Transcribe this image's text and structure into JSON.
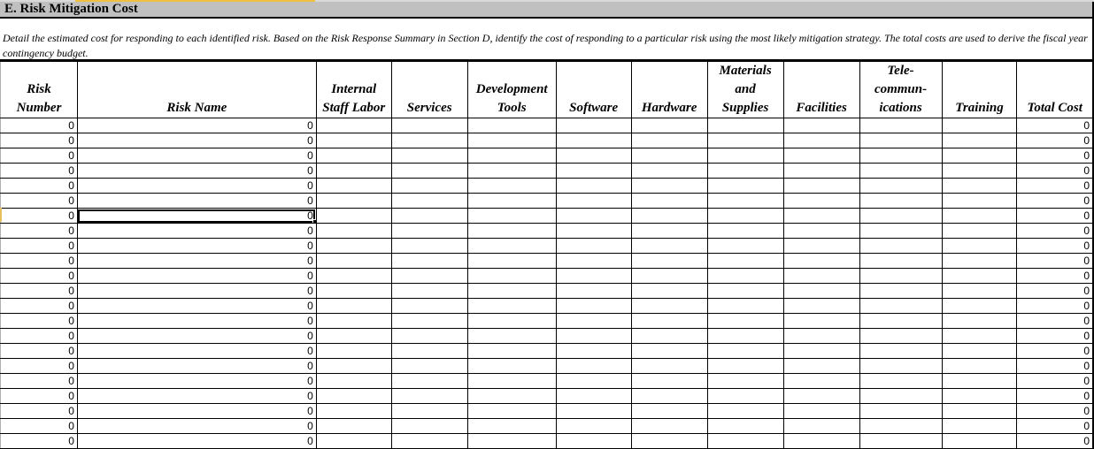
{
  "section": {
    "title": "E.  Risk Mitigation Cost",
    "description": "Detail the estimated cost for responding to each identified risk.  Based on the Risk Response Summary in Section D, identify the cost of responding to a particular risk using the most likely mitigation strategy.  The total costs are used to derive the fiscal year contingency budget."
  },
  "table": {
    "columns": [
      {
        "key": "risk_number",
        "label": "Risk Number"
      },
      {
        "key": "risk_name",
        "label": "Risk Name"
      },
      {
        "key": "internal_staff_labor",
        "label": "Internal Staff Labor"
      },
      {
        "key": "services",
        "label": "Services"
      },
      {
        "key": "development_tools",
        "label": "Development Tools"
      },
      {
        "key": "software",
        "label": "Software"
      },
      {
        "key": "hardware",
        "label": "Hardware"
      },
      {
        "key": "materials_and_supplies",
        "label": "Materials and Supplies"
      },
      {
        "key": "facilities",
        "label": "Facilities"
      },
      {
        "key": "telecommunications",
        "label": "Tele-communications"
      },
      {
        "key": "training",
        "label": "Training"
      },
      {
        "key": "total_cost",
        "label": "Total Cost"
      }
    ],
    "header_lines": [
      [
        "Risk",
        "Number"
      ],
      [
        "Risk Name"
      ],
      [
        "Internal",
        "Staff Labor"
      ],
      [
        "Services"
      ],
      [
        "Development",
        "Tools"
      ],
      [
        "Software"
      ],
      [
        "Hardware"
      ],
      [
        "Materials",
        "and",
        "Supplies"
      ],
      [
        "Facilities"
      ],
      [
        "Tele-",
        "commun-",
        "ications"
      ],
      [
        "Training"
      ],
      [
        "Total Cost"
      ]
    ],
    "rows": [
      [
        "0",
        "0",
        "",
        "",
        "",
        "",
        "",
        "",
        "",
        "",
        "",
        "0"
      ],
      [
        "0",
        "0",
        "",
        "",
        "",
        "",
        "",
        "",
        "",
        "",
        "",
        "0"
      ],
      [
        "0",
        "0",
        "",
        "",
        "",
        "",
        "",
        "",
        "",
        "",
        "",
        "0"
      ],
      [
        "0",
        "0",
        "",
        "",
        "",
        "",
        "",
        "",
        "",
        "",
        "",
        "0"
      ],
      [
        "0",
        "0",
        "",
        "",
        "",
        "",
        "",
        "",
        "",
        "",
        "",
        "0"
      ],
      [
        "0",
        "0",
        "",
        "",
        "",
        "",
        "",
        "",
        "",
        "",
        "",
        "0"
      ],
      [
        "0",
        "0",
        "",
        "",
        "",
        "",
        "",
        "",
        "",
        "",
        "",
        "0"
      ],
      [
        "0",
        "0",
        "",
        "",
        "",
        "",
        "",
        "",
        "",
        "",
        "",
        "0"
      ],
      [
        "0",
        "0",
        "",
        "",
        "",
        "",
        "",
        "",
        "",
        "",
        "",
        "0"
      ],
      [
        "0",
        "0",
        "",
        "",
        "",
        "",
        "",
        "",
        "",
        "",
        "",
        "0"
      ],
      [
        "0",
        "0",
        "",
        "",
        "",
        "",
        "",
        "",
        "",
        "",
        "",
        "0"
      ],
      [
        "0",
        "0",
        "",
        "",
        "",
        "",
        "",
        "",
        "",
        "",
        "",
        "0"
      ],
      [
        "0",
        "0",
        "",
        "",
        "",
        "",
        "",
        "",
        "",
        "",
        "",
        "0"
      ],
      [
        "0",
        "0",
        "",
        "",
        "",
        "",
        "",
        "",
        "",
        "",
        "",
        "0"
      ],
      [
        "0",
        "0",
        "",
        "",
        "",
        "",
        "",
        "",
        "",
        "",
        "",
        "0"
      ],
      [
        "0",
        "0",
        "",
        "",
        "",
        "",
        "",
        "",
        "",
        "",
        "",
        "0"
      ],
      [
        "0",
        "0",
        "",
        "",
        "",
        "",
        "",
        "",
        "",
        "",
        "",
        "0"
      ],
      [
        "0",
        "0",
        "",
        "",
        "",
        "",
        "",
        "",
        "",
        "",
        "",
        "0"
      ],
      [
        "0",
        "0",
        "",
        "",
        "",
        "",
        "",
        "",
        "",
        "",
        "",
        "0"
      ],
      [
        "0",
        "0",
        "",
        "",
        "",
        "",
        "",
        "",
        "",
        "",
        "",
        "0"
      ],
      [
        "0",
        "0",
        "",
        "",
        "",
        "",
        "",
        "",
        "",
        "",
        "",
        "0"
      ],
      [
        "0",
        "0",
        "",
        "",
        "",
        "",
        "",
        "",
        "",
        "",
        "",
        "0"
      ]
    ],
    "active_cell": {
      "row": 6,
      "col": 1
    }
  },
  "colors": {
    "section_bar": "#c0c0c0",
    "selection_highlight": "#f0c040",
    "grid_line": "#000000"
  }
}
